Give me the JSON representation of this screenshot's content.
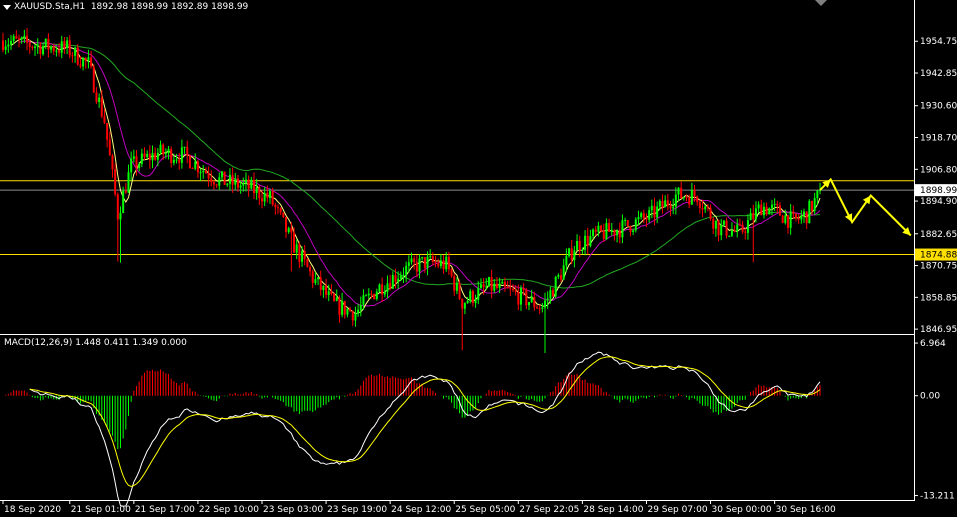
{
  "header": {
    "symbol_info": "XAUUSD.Sta,H1  1892.98 1898.99 1892.89 1898.99",
    "macd_info": "MACD(12,26,9) 1.448 0.411 1.349 0.000"
  },
  "colors": {
    "background": "#000000",
    "axis": "#ffffff",
    "bull": "#00ff00",
    "bear": "#ff0000",
    "ma_fast": "#ffff80",
    "ma_mid": "#c000c0",
    "ma_slow": "#22aa22",
    "level_line": "#ffe000",
    "bid_line": "#8c8c8c",
    "forecast": "#ffff00",
    "macd_line": "#ffffff",
    "signal_line": "#ffff00"
  },
  "chart_data": [
    {
      "type": "candlestick",
      "name": "XAUUSD.Sta,H1",
      "y_ticks": [
        "1954.75",
        "1942.85",
        "1930.60",
        "1918.70",
        "1906.80",
        "1894.90",
        "1882.65",
        "1870.75",
        "1858.85",
        "1846.95"
      ],
      "y_values": [
        1954.75,
        1942.85,
        1930.6,
        1918.7,
        1906.8,
        1894.9,
        1882.65,
        1870.75,
        1858.85,
        1846.95
      ],
      "ylim": [
        1845.5,
        1964.2
      ],
      "current_price_label": "1898.99",
      "current_price": 1898.99,
      "level_label": "1874.88",
      "levels": [
        1902.5,
        1874.88
      ],
      "path_keypoints": [
        {
          "t": 0,
          "p": 1955
        },
        {
          "t": 14,
          "p": 1953
        },
        {
          "t": 24,
          "p": 1952
        },
        {
          "t": 32,
          "p": 1946
        },
        {
          "t": 38,
          "p": 1925
        },
        {
          "t": 43,
          "p": 1890
        },
        {
          "t": 48,
          "p": 1908
        },
        {
          "t": 58,
          "p": 1913
        },
        {
          "t": 68,
          "p": 1912
        },
        {
          "t": 80,
          "p": 1903
        },
        {
          "t": 92,
          "p": 1900
        },
        {
          "t": 100,
          "p": 1896
        },
        {
          "t": 108,
          "p": 1880
        },
        {
          "t": 116,
          "p": 1866
        },
        {
          "t": 124,
          "p": 1856
        },
        {
          "t": 132,
          "p": 1853
        },
        {
          "t": 140,
          "p": 1862
        },
        {
          "t": 150,
          "p": 1869
        },
        {
          "t": 158,
          "p": 1872
        },
        {
          "t": 166,
          "p": 1871
        },
        {
          "t": 172,
          "p": 1857
        },
        {
          "t": 182,
          "p": 1863
        },
        {
          "t": 192,
          "p": 1860
        },
        {
          "t": 202,
          "p": 1855
        },
        {
          "t": 208,
          "p": 1866
        },
        {
          "t": 214,
          "p": 1878
        },
        {
          "t": 222,
          "p": 1882
        },
        {
          "t": 232,
          "p": 1885
        },
        {
          "t": 242,
          "p": 1889
        },
        {
          "t": 252,
          "p": 1897
        },
        {
          "t": 260,
          "p": 1897
        },
        {
          "t": 268,
          "p": 1885
        },
        {
          "t": 276,
          "p": 1883
        },
        {
          "t": 284,
          "p": 1893
        },
        {
          "t": 290,
          "p": 1891
        },
        {
          "t": 296,
          "p": 1887
        },
        {
          "t": 301,
          "p": 1890
        },
        {
          "t": 306,
          "p": 1898
        }
      ],
      "forecast_path": [
        {
          "t": 306,
          "p": 1898.99
        },
        {
          "t": 310,
          "p": 1903
        },
        {
          "t": 318,
          "p": 1887
        },
        {
          "t": 325,
          "p": 1897
        },
        {
          "t": 340,
          "p": 1882
        }
      ],
      "bars_total": 307
    },
    {
      "type": "macd",
      "name": "MACD(12,26,9)",
      "params": [
        12,
        26,
        9
      ],
      "current_values": [
        1.448,
        0.411,
        1.349,
        0.0
      ],
      "y_ticks": [
        "6.964",
        "0.00",
        "-13.211"
      ],
      "y_values": [
        6.964,
        0.0,
        -13.211
      ],
      "ylim": [
        -13.8,
        7.9
      ]
    }
  ],
  "x_axis": {
    "labels": [
      {
        "text": "18 Sep 2020",
        "t": 0
      },
      {
        "text": "21 Sep 01:00",
        "t": 25
      },
      {
        "text": "21 Sep 17:00",
        "t": 49
      },
      {
        "text": "22 Sep 10:00",
        "t": 73
      },
      {
        "text": "23 Sep 03:00",
        "t": 97
      },
      {
        "text": "23 Sep 19:00",
        "t": 121
      },
      {
        "text": "24 Sep 12:00",
        "t": 145
      },
      {
        "text": "25 Sep 05:00",
        "t": 169
      },
      {
        "text": "27 Sep 22:05",
        "t": 193
      },
      {
        "text": "28 Sep 14:00",
        "t": 217
      },
      {
        "text": "29 Sep 07:00",
        "t": 241
      },
      {
        "text": "30 Sep 00:00",
        "t": 265
      },
      {
        "text": "30 Sep 16:00",
        "t": 289
      }
    ]
  }
}
